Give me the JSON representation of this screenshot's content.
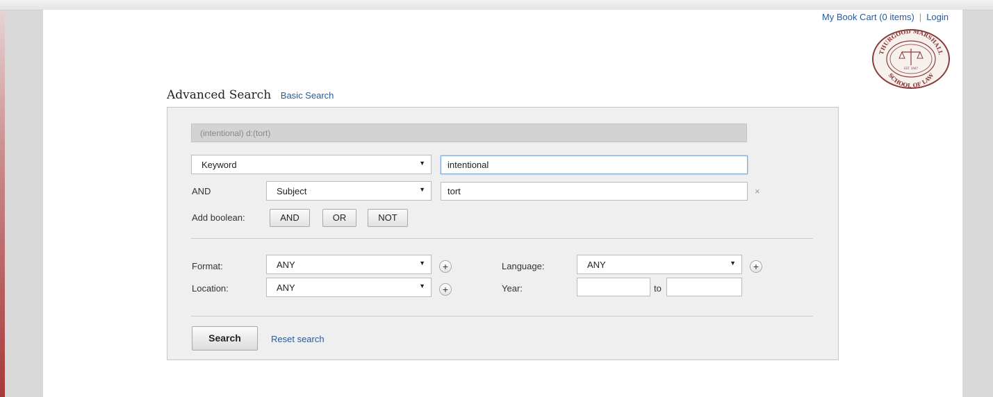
{
  "header": {
    "cart_link": "My Book Cart (0 items)",
    "separator": "|",
    "login_link": "Login",
    "seal_text_top": "THURGOOD MARSHALL",
    "seal_text_bottom": "SCHOOL OF LAW",
    "seal_est": "EST. 1947"
  },
  "heading": {
    "title": "Advanced Search",
    "basic_link": "Basic Search"
  },
  "query": {
    "display": "(intentional) d:(tort)"
  },
  "rows": [
    {
      "field": "Keyword",
      "value": "intentional"
    },
    {
      "operator": "AND",
      "field": "Subject",
      "value": "tort",
      "remove": "×"
    }
  ],
  "boolean": {
    "label": "Add boolean:",
    "buttons": [
      "AND",
      "OR",
      "NOT"
    ]
  },
  "filters": {
    "format_label": "Format:",
    "format_value": "ANY",
    "location_label": "Location:",
    "location_value": "ANY",
    "language_label": "Language:",
    "language_value": "ANY",
    "year_label": "Year:",
    "year_from": "",
    "year_to_label": "to",
    "year_to": ""
  },
  "icons": {
    "dropdown": "▼",
    "plus": "+"
  },
  "actions": {
    "search_label": "Search",
    "reset_label": "Reset search"
  },
  "colors": {
    "link": "#2a5a9a",
    "panel": "#efefef",
    "accent_bar": "#a63a3a",
    "seal": "#8a3b3b"
  }
}
